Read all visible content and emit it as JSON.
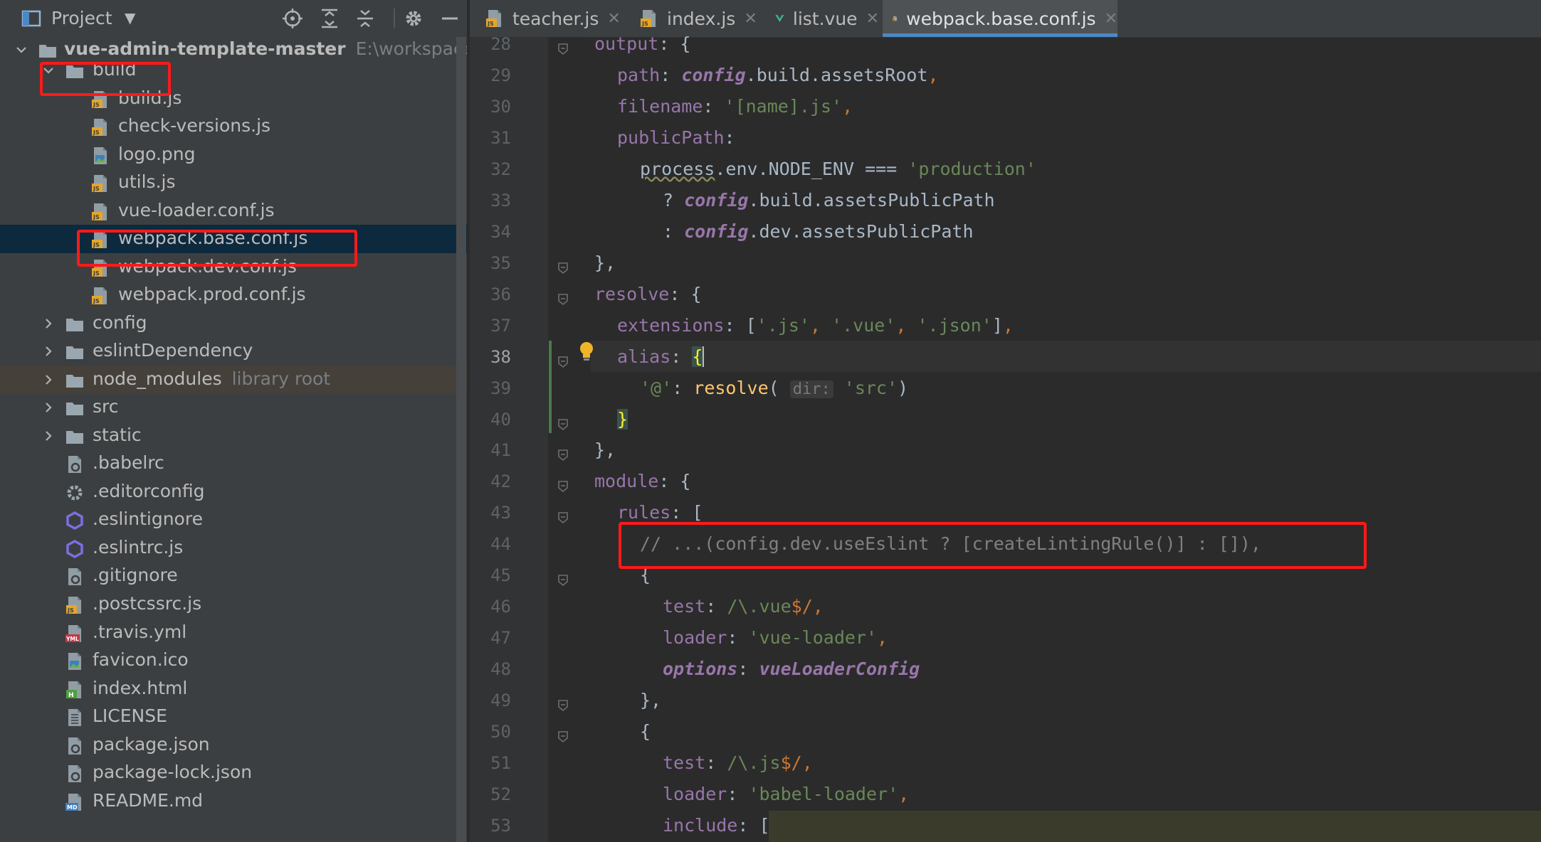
{
  "project_panel": {
    "title": "Project",
    "root": {
      "name": "vue-admin-template-master",
      "path": "E:\\workspace\\javal"
    },
    "library_root_hint": "library root",
    "items": [
      {
        "label": "build",
        "type": "folder",
        "depth": 1,
        "expanded": true
      },
      {
        "label": "build.js",
        "type": "js",
        "depth": 2
      },
      {
        "label": "check-versions.js",
        "type": "js",
        "depth": 2
      },
      {
        "label": "logo.png",
        "type": "png",
        "depth": 2
      },
      {
        "label": "utils.js",
        "type": "js",
        "depth": 2
      },
      {
        "label": "vue-loader.conf.js",
        "type": "js",
        "depth": 2
      },
      {
        "label": "webpack.base.conf.js",
        "type": "js",
        "depth": 2,
        "selected": true
      },
      {
        "label": "webpack.dev.conf.js",
        "type": "js",
        "depth": 2
      },
      {
        "label": "webpack.prod.conf.js",
        "type": "js",
        "depth": 2
      },
      {
        "label": "config",
        "type": "folder",
        "depth": 1
      },
      {
        "label": "eslintDependency",
        "type": "folder",
        "depth": 1
      },
      {
        "label": "node_modules",
        "type": "folder",
        "depth": 1,
        "library_root": true
      },
      {
        "label": "src",
        "type": "folder",
        "depth": 1
      },
      {
        "label": "static",
        "type": "folder",
        "depth": 1
      },
      {
        "label": ".babelrc",
        "type": "config",
        "depth": 1
      },
      {
        "label": ".editorconfig",
        "type": "gear",
        "depth": 1
      },
      {
        "label": ".eslintignore",
        "type": "eslint",
        "depth": 1
      },
      {
        "label": ".eslintrc.js",
        "type": "eslint",
        "depth": 1
      },
      {
        "label": ".gitignore",
        "type": "config",
        "depth": 1
      },
      {
        "label": ".postcssrc.js",
        "type": "js",
        "depth": 1
      },
      {
        "label": ".travis.yml",
        "type": "yml",
        "depth": 1
      },
      {
        "label": "favicon.ico",
        "type": "png",
        "depth": 1
      },
      {
        "label": "index.html",
        "type": "html",
        "depth": 1
      },
      {
        "label": "LICENSE",
        "type": "text",
        "depth": 1
      },
      {
        "label": "package.json",
        "type": "config",
        "depth": 1
      },
      {
        "label": "package-lock.json",
        "type": "config",
        "depth": 1
      },
      {
        "label": "README.md",
        "type": "md",
        "depth": 1
      }
    ]
  },
  "tabs": [
    {
      "label": "teacher.js",
      "icon": "js-file-icon"
    },
    {
      "label": "index.js",
      "icon": "js-file-icon"
    },
    {
      "label": "list.vue",
      "icon": "vue-file-icon"
    },
    {
      "label": "webpack.base.conf.js",
      "icon": "js-file-icon",
      "active": true
    }
  ],
  "editor": {
    "current_line": 38,
    "line_numbers": [
      "28",
      "29",
      "30",
      "31",
      "32",
      "33",
      "34",
      "35",
      "36",
      "37",
      "38",
      "39",
      "40",
      "41",
      "42",
      "43",
      "44",
      "45",
      "46",
      "47",
      "48",
      "49",
      "50",
      "51",
      "52",
      "53"
    ],
    "param_hint": "dir:",
    "code": {
      "l28_key": "output",
      "l28_rest": ": {",
      "l29_key": "path",
      "l29_cfg": "config",
      "l29_rest": ".build.assetsRoot",
      "l30_key": "filename",
      "l30_str": "'[name].js'",
      "l31_key": "publicPath",
      "l32_proc": "process",
      "l32_rest": ".env.NODE_ENV === ",
      "l32_str": "'production'",
      "l33_pre": "? ",
      "l33_cfg": "config",
      "l33_rest": ".build.assetsPublicPath",
      "l34_pre": ": ",
      "l34_cfg": "config",
      "l34_rest": ".dev.assetsPublicPath",
      "l35": "},",
      "l36_key": "resolve",
      "l37_key": "extensions",
      "l37_s1": "'.js'",
      "l37_s2": "'.vue'",
      "l37_s3": "'.json'",
      "l38_key": "alias",
      "l39_str": "'@'",
      "l39_fn": "resolve",
      "l39_arg": "'src'",
      "l40": "}",
      "l41": "},",
      "l42_key": "module",
      "l43_key": "rules",
      "l44_comment": "// ...(config.dev.useEslint ? [createLintingRule()] : []),",
      "l45": "{",
      "l46_key": "test",
      "l46_re1": "/\\.",
      "l46_re2": "vue",
      "l46_re3": "$/",
      "l47_key": "loader",
      "l47_str": "'vue-loader'",
      "l48_key": "options",
      "l48_val": "vueLoaderConfig",
      "l49": "},",
      "l50": "{",
      "l51_key": "test",
      "l51_re1": "/\\.",
      "l51_re2": "js",
      "l51_re3": "$/",
      "l52_key": "loader",
      "l52_str": "'babel-loader'",
      "l53_key": "include",
      "l53_rest": ": ["
    }
  },
  "colors": {
    "highlight_box": "#ff1a1a",
    "selection": "#0d293e",
    "active_tab_underline": "#4a88c7"
  }
}
